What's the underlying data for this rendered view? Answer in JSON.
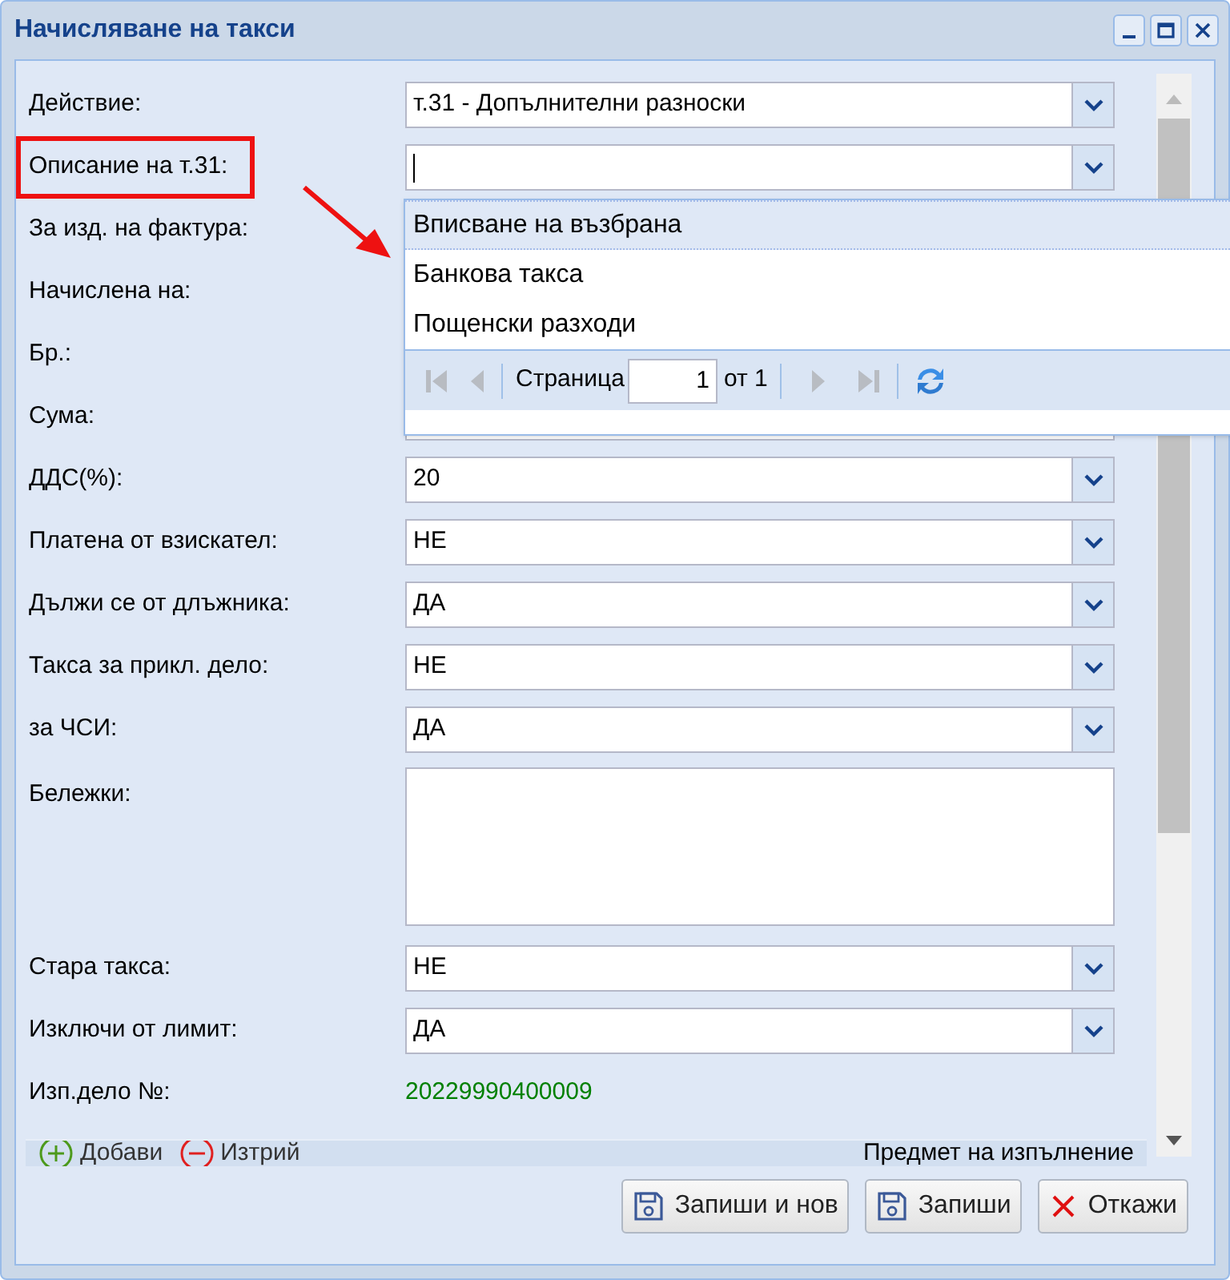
{
  "window": {
    "title": "Начисляване на такси"
  },
  "form": {
    "fields": [
      {
        "label": "Действие:",
        "kind": "combo",
        "value": "т.31 - Допълнителни разноски"
      },
      {
        "label": "Описание на т.31:",
        "kind": "combo",
        "focused": true,
        "annotated": true
      },
      {
        "label": "За изд. на фактура:",
        "kind": "covered"
      },
      {
        "label": "Начислена на:",
        "kind": "covered"
      },
      {
        "label": "Бр.:",
        "kind": "covered"
      },
      {
        "label": "Сума:",
        "kind": "text"
      },
      {
        "label": "ДДС(%):",
        "kind": "combo",
        "value": "20"
      },
      {
        "label": "Платена от взискател:",
        "kind": "combo",
        "value": "НЕ"
      },
      {
        "label": "Дължи се от длъжника:",
        "kind": "combo",
        "value": "ДА"
      },
      {
        "label": "Такса за прикл. дело:",
        "kind": "combo",
        "value": "НЕ"
      },
      {
        "label": "за ЧСИ:",
        "kind": "combo",
        "value": "ДА"
      },
      {
        "label": "Бележки:",
        "kind": "textarea"
      },
      {
        "label": "Стара такса:",
        "kind": "combo",
        "value": "НЕ"
      },
      {
        "label": "Изключи от лимит:",
        "kind": "combo",
        "value": "ДА"
      },
      {
        "label": "Изп.дело №:",
        "kind": "display",
        "value": "20229990400009"
      }
    ]
  },
  "dropdown": {
    "items": [
      {
        "label": "Вписване на възбрана",
        "selected": true
      },
      {
        "label": "Банкова такса",
        "selected": false
      },
      {
        "label": "Пощенски разходи",
        "selected": false
      }
    ],
    "pager": {
      "page_label": "Страница",
      "page": "1",
      "of": "от 1"
    }
  },
  "toolbar": {
    "add": "Добави",
    "delete": "Изтрий",
    "column": "Предмет на изпълнение"
  },
  "buttons": [
    {
      "label": "Запиши и нов"
    },
    {
      "label": "Запиши"
    },
    {
      "label": "Откажи"
    }
  ]
}
